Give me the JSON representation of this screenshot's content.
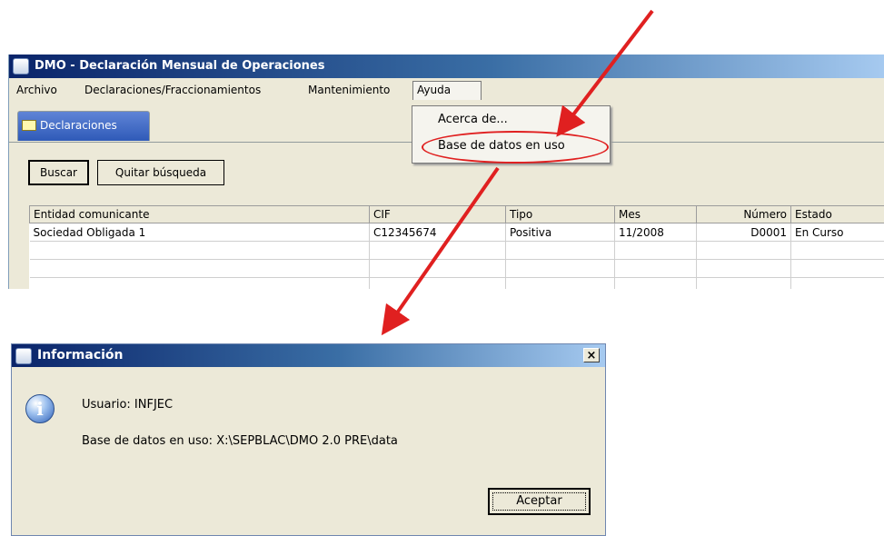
{
  "app": {
    "title": "DMO - Declaración Mensual de Operaciones",
    "menu": [
      "Archivo",
      "Declaraciones/Fraccionamientos",
      "Mantenimiento",
      "Ayuda"
    ],
    "help_menu": [
      "Acerca de...",
      "Base de datos en uso"
    ],
    "tab": "Declaraciones",
    "buttons": {
      "search": "Buscar",
      "clear": "Quitar búsqueda"
    },
    "table": {
      "columns": [
        "Entidad comunicante",
        "CIF",
        "Tipo",
        "Mes",
        "Número",
        "Estado"
      ],
      "rows": [
        [
          "Sociedad Obligada 1",
          "C12345674",
          "Positiva",
          "11/2008",
          "D0001",
          "En Curso"
        ]
      ]
    }
  },
  "dialog": {
    "title": "Información",
    "close": "×",
    "user_line": "Usuario: INFJEC",
    "db_line": "Base de datos en uso: X:\\SEPBLAC\\DMO 2.0 PRE\\data",
    "ok_label": "Aceptar"
  },
  "colors": {
    "annotation_arrow": "#e02020",
    "title_bar": "#0a246a"
  }
}
